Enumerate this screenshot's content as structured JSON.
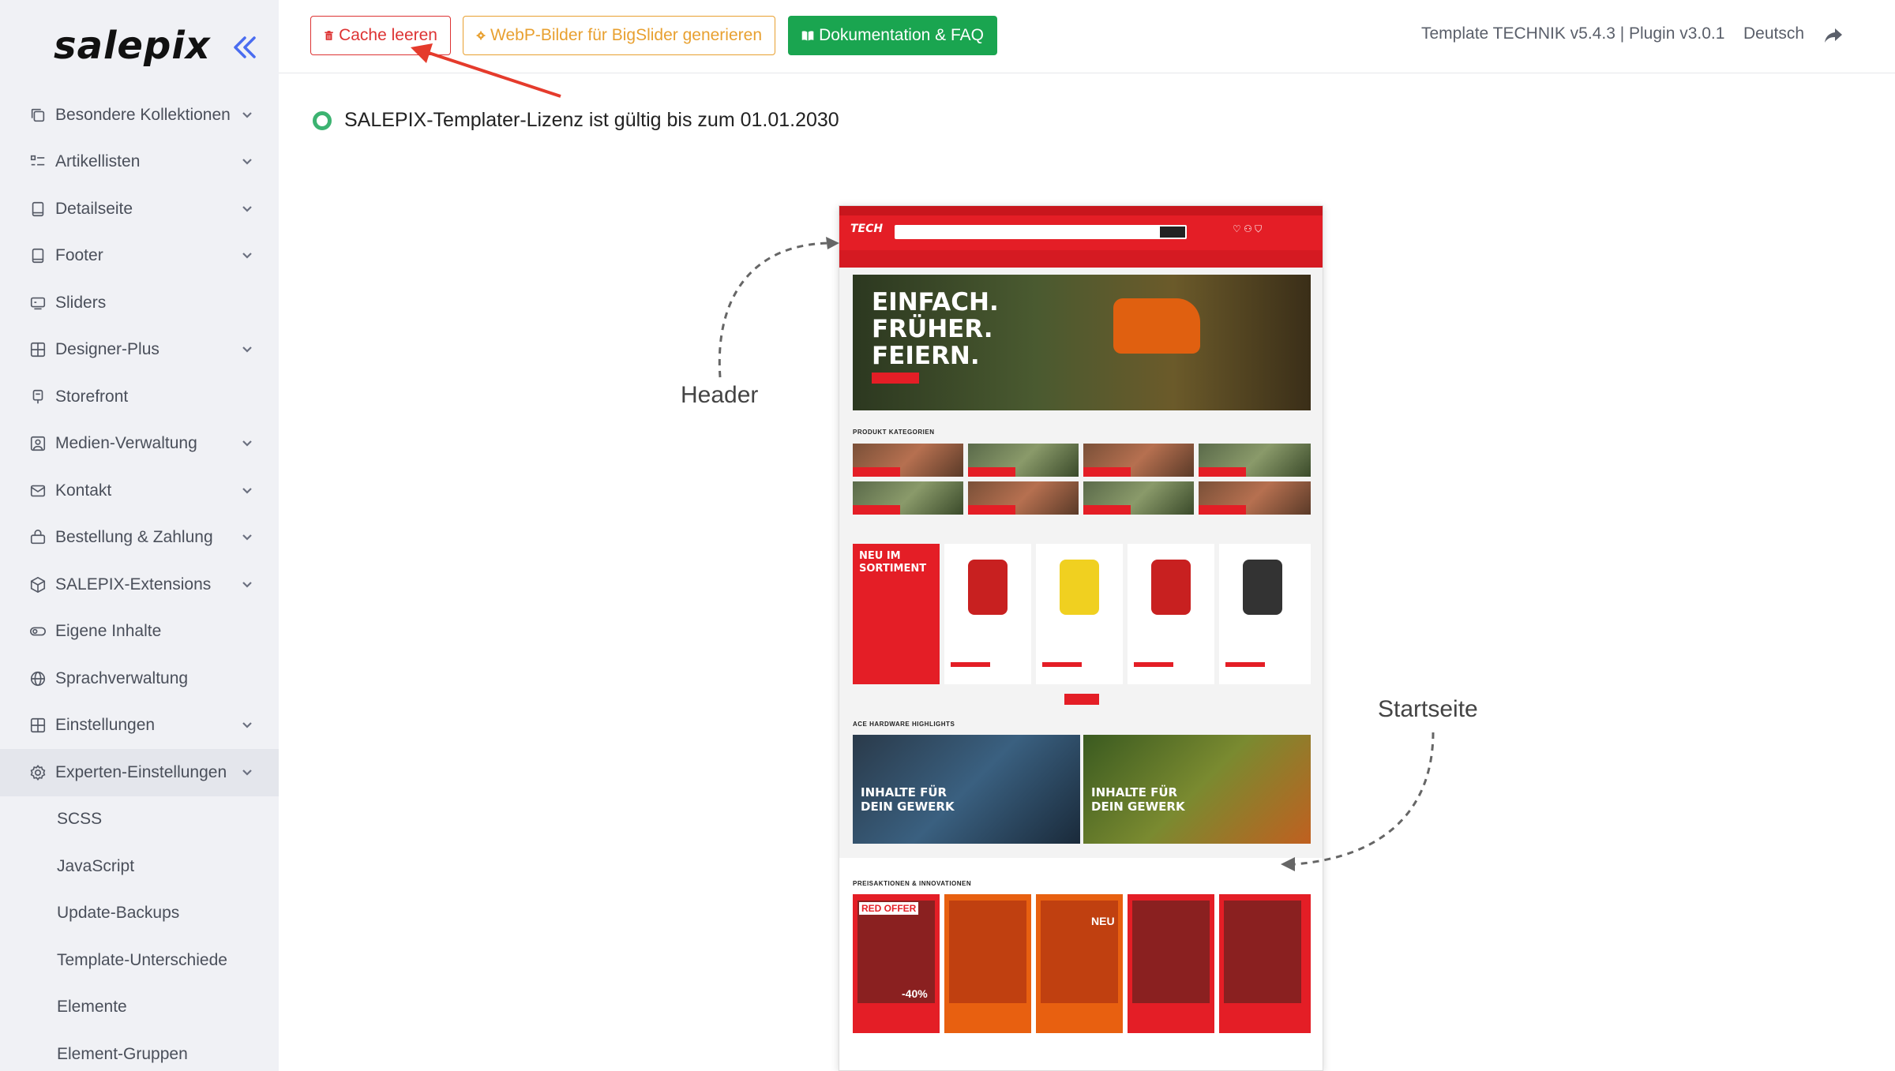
{
  "app": {
    "logo": "salepix"
  },
  "sidebar": {
    "items": [
      {
        "label": "Besondere Kollektionen",
        "icon": "collections-icon",
        "expandable": true
      },
      {
        "label": "Artikellisten",
        "icon": "list-icon",
        "expandable": true
      },
      {
        "label": "Detailseite",
        "icon": "page-icon",
        "expandable": true
      },
      {
        "label": "Footer",
        "icon": "footer-icon",
        "expandable": true
      },
      {
        "label": "Sliders",
        "icon": "slider-icon",
        "expandable": false
      },
      {
        "label": "Designer-Plus",
        "icon": "grid-icon",
        "expandable": true
      },
      {
        "label": "Storefront",
        "icon": "storefront-icon",
        "expandable": false
      },
      {
        "label": "Medien-Verwaltung",
        "icon": "image-icon",
        "expandable": true
      },
      {
        "label": "Kontakt",
        "icon": "mail-icon",
        "expandable": true
      },
      {
        "label": "Bestellung & Zahlung",
        "icon": "basket-icon",
        "expandable": true
      },
      {
        "label": "SALEPIX-Extensions",
        "icon": "box-icon",
        "expandable": true
      },
      {
        "label": "Eigene Inhalte",
        "icon": "toggle-icon",
        "expandable": false
      },
      {
        "label": "Sprachverwaltung",
        "icon": "globe-icon",
        "expandable": false
      },
      {
        "label": "Einstellungen",
        "icon": "settings-grid-icon",
        "expandable": true
      },
      {
        "label": "Experten-Einstellungen",
        "icon": "gear-icon",
        "expandable": true,
        "active": true
      }
    ],
    "subitems": [
      "SCSS",
      "JavaScript",
      "Update-Backups",
      "Template-Unterschiede",
      "Elemente",
      "Element-Gruppen"
    ]
  },
  "toolbar": {
    "cache_label": "Cache leeren",
    "webp_label": "WebP-Bilder für BigSlider generieren",
    "doc_label": "Dokumentation & FAQ",
    "version": "Template TECHNIK v5.4.3 | Plugin v3.0.1",
    "language": "Deutsch"
  },
  "license": {
    "text": "SALEPIX-Templater-Lizenz ist gültig bis zum 01.01.2030"
  },
  "annotations": {
    "header": "Header",
    "start": "Startseite"
  },
  "preview": {
    "logo": "TECH",
    "hero_line1": "EINFACH.",
    "hero_line2": "FRÜHER.",
    "hero_line3": "FEIERN.",
    "section_categories": "PRODUKT KATEGORIEN",
    "new_in_line1": "NEU IM",
    "new_in_line2": "SORTIMENT",
    "section_highlights": "ACE HARDWARE HIGHLIGHTS",
    "banner_line1": "INHALTE FÜR",
    "banner_line2": "DEIN GEWERK",
    "section_offers": "PREISAKTIONEN & INNOVATIONEN",
    "offer_badge": "RED OFFER",
    "offer_discount": "-40%",
    "offer_new": "NEU"
  },
  "colors": {
    "cache": "#dd3333",
    "webp": "#e8a030",
    "doc": "#1aa550",
    "license_dot": "#3cb371",
    "preview_red": "#e41e26",
    "arrow": "#e53b2c"
  }
}
